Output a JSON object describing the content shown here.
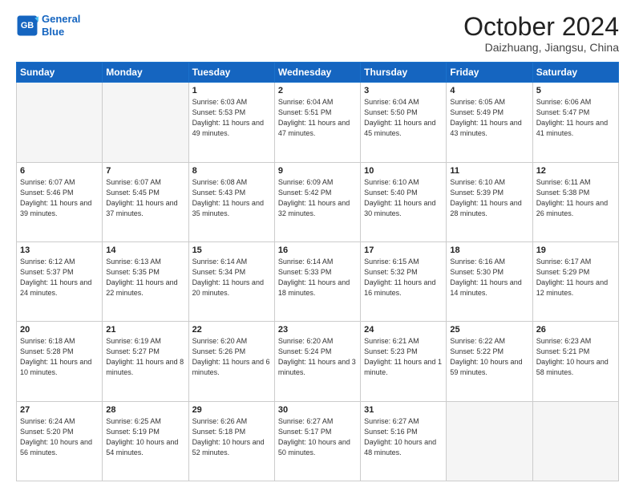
{
  "header": {
    "logo_line1": "General",
    "logo_line2": "Blue",
    "month": "October 2024",
    "location": "Daizhuang, Jiangsu, China"
  },
  "weekdays": [
    "Sunday",
    "Monday",
    "Tuesday",
    "Wednesday",
    "Thursday",
    "Friday",
    "Saturday"
  ],
  "weeks": [
    [
      {
        "day": "",
        "info": ""
      },
      {
        "day": "",
        "info": ""
      },
      {
        "day": "1",
        "info": "Sunrise: 6:03 AM\nSunset: 5:53 PM\nDaylight: 11 hours and 49 minutes."
      },
      {
        "day": "2",
        "info": "Sunrise: 6:04 AM\nSunset: 5:51 PM\nDaylight: 11 hours and 47 minutes."
      },
      {
        "day": "3",
        "info": "Sunrise: 6:04 AM\nSunset: 5:50 PM\nDaylight: 11 hours and 45 minutes."
      },
      {
        "day": "4",
        "info": "Sunrise: 6:05 AM\nSunset: 5:49 PM\nDaylight: 11 hours and 43 minutes."
      },
      {
        "day": "5",
        "info": "Sunrise: 6:06 AM\nSunset: 5:47 PM\nDaylight: 11 hours and 41 minutes."
      }
    ],
    [
      {
        "day": "6",
        "info": "Sunrise: 6:07 AM\nSunset: 5:46 PM\nDaylight: 11 hours and 39 minutes."
      },
      {
        "day": "7",
        "info": "Sunrise: 6:07 AM\nSunset: 5:45 PM\nDaylight: 11 hours and 37 minutes."
      },
      {
        "day": "8",
        "info": "Sunrise: 6:08 AM\nSunset: 5:43 PM\nDaylight: 11 hours and 35 minutes."
      },
      {
        "day": "9",
        "info": "Sunrise: 6:09 AM\nSunset: 5:42 PM\nDaylight: 11 hours and 32 minutes."
      },
      {
        "day": "10",
        "info": "Sunrise: 6:10 AM\nSunset: 5:40 PM\nDaylight: 11 hours and 30 minutes."
      },
      {
        "day": "11",
        "info": "Sunrise: 6:10 AM\nSunset: 5:39 PM\nDaylight: 11 hours and 28 minutes."
      },
      {
        "day": "12",
        "info": "Sunrise: 6:11 AM\nSunset: 5:38 PM\nDaylight: 11 hours and 26 minutes."
      }
    ],
    [
      {
        "day": "13",
        "info": "Sunrise: 6:12 AM\nSunset: 5:37 PM\nDaylight: 11 hours and 24 minutes."
      },
      {
        "day": "14",
        "info": "Sunrise: 6:13 AM\nSunset: 5:35 PM\nDaylight: 11 hours and 22 minutes."
      },
      {
        "day": "15",
        "info": "Sunrise: 6:14 AM\nSunset: 5:34 PM\nDaylight: 11 hours and 20 minutes."
      },
      {
        "day": "16",
        "info": "Sunrise: 6:14 AM\nSunset: 5:33 PM\nDaylight: 11 hours and 18 minutes."
      },
      {
        "day": "17",
        "info": "Sunrise: 6:15 AM\nSunset: 5:32 PM\nDaylight: 11 hours and 16 minutes."
      },
      {
        "day": "18",
        "info": "Sunrise: 6:16 AM\nSunset: 5:30 PM\nDaylight: 11 hours and 14 minutes."
      },
      {
        "day": "19",
        "info": "Sunrise: 6:17 AM\nSunset: 5:29 PM\nDaylight: 11 hours and 12 minutes."
      }
    ],
    [
      {
        "day": "20",
        "info": "Sunrise: 6:18 AM\nSunset: 5:28 PM\nDaylight: 11 hours and 10 minutes."
      },
      {
        "day": "21",
        "info": "Sunrise: 6:19 AM\nSunset: 5:27 PM\nDaylight: 11 hours and 8 minutes."
      },
      {
        "day": "22",
        "info": "Sunrise: 6:20 AM\nSunset: 5:26 PM\nDaylight: 11 hours and 6 minutes."
      },
      {
        "day": "23",
        "info": "Sunrise: 6:20 AM\nSunset: 5:24 PM\nDaylight: 11 hours and 3 minutes."
      },
      {
        "day": "24",
        "info": "Sunrise: 6:21 AM\nSunset: 5:23 PM\nDaylight: 11 hours and 1 minute."
      },
      {
        "day": "25",
        "info": "Sunrise: 6:22 AM\nSunset: 5:22 PM\nDaylight: 10 hours and 59 minutes."
      },
      {
        "day": "26",
        "info": "Sunrise: 6:23 AM\nSunset: 5:21 PM\nDaylight: 10 hours and 58 minutes."
      }
    ],
    [
      {
        "day": "27",
        "info": "Sunrise: 6:24 AM\nSunset: 5:20 PM\nDaylight: 10 hours and 56 minutes."
      },
      {
        "day": "28",
        "info": "Sunrise: 6:25 AM\nSunset: 5:19 PM\nDaylight: 10 hours and 54 minutes."
      },
      {
        "day": "29",
        "info": "Sunrise: 6:26 AM\nSunset: 5:18 PM\nDaylight: 10 hours and 52 minutes."
      },
      {
        "day": "30",
        "info": "Sunrise: 6:27 AM\nSunset: 5:17 PM\nDaylight: 10 hours and 50 minutes."
      },
      {
        "day": "31",
        "info": "Sunrise: 6:27 AM\nSunset: 5:16 PM\nDaylight: 10 hours and 48 minutes."
      },
      {
        "day": "",
        "info": ""
      },
      {
        "day": "",
        "info": ""
      }
    ]
  ]
}
